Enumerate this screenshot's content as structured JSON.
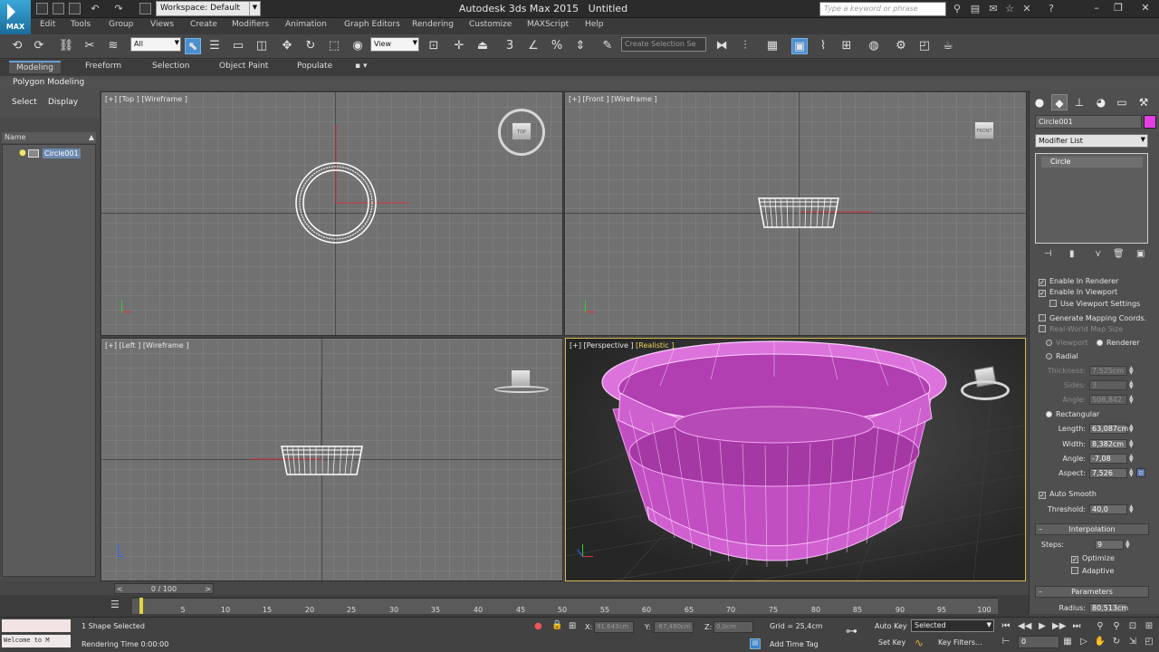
{
  "title_bar": {
    "app_title": "Autodesk 3ds Max  2015",
    "doc_title": "Untitled",
    "workspace": "Workspace: Default",
    "search_placeholder": "Type a keyword or phrase",
    "logo_text": "MAX"
  },
  "menu": [
    "Edit",
    "Tools",
    "Group",
    "Views",
    "Create",
    "Modifiers",
    "Animation",
    "Graph Editors",
    "Rendering",
    "Customize",
    "MAXScript",
    "Help"
  ],
  "toolbar": {
    "selection_filter": "All",
    "reference_coord": "View",
    "named_selection": "Create Selection Se"
  },
  "ribbon": {
    "tabs": [
      "Modeling",
      "Freeform",
      "Selection",
      "Object Paint",
      "Populate"
    ],
    "active": "Modeling",
    "sub_label": "Polygon Modeling"
  },
  "explorer": {
    "tabs": [
      "Select",
      "Display"
    ],
    "column": "Name",
    "object": "Circle001"
  },
  "viewports": {
    "top": "[+] [Top ] [Wireframe ]",
    "front": "[+] [Front ] [Wireframe ]",
    "left": "[+] [Left ] [Wireframe ]",
    "persp_a": "[+] [Perspective ]",
    "persp_b": "[Realistic ]",
    "cube_top": "TOP",
    "cube_front": "FRONT"
  },
  "command_panel": {
    "object_name": "Circle001",
    "object_color": "#e43ee4",
    "modifier_list": "Modifier List",
    "stack_item": "Circle",
    "enable_renderer": "Enable In Renderer",
    "enable_viewport": "Enable In Viewport",
    "use_viewport_settings": "Use Viewport Settings",
    "gen_mapping": "Generate Mapping Coords.",
    "real_world": "Real-World Map Size",
    "viewport_radio": "Viewport",
    "renderer_radio": "Renderer",
    "radial": "Radial",
    "thickness_label": "Thickness:",
    "thickness": "7,525cm",
    "sides_label": "Sides:",
    "sides": "3",
    "angle_label": "Angle:",
    "angle_radial": "508,842",
    "rectangular": "Rectangular",
    "length_label": "Length:",
    "length": "63,087cm",
    "width_label": "Width:",
    "width": "8,382cm",
    "angle_rect": "-7,08",
    "aspect_label": "Aspect:",
    "aspect": "7,526",
    "auto_smooth": "Auto Smooth",
    "threshold_label": "Threshold:",
    "threshold": "40,0",
    "interpolation": "Interpolation",
    "steps_label": "Steps:",
    "steps": "9",
    "optimize": "Optimize",
    "adaptive": "Adaptive",
    "parameters": "Parameters",
    "radius_label": "Radius:",
    "radius": "80,513cm"
  },
  "timeline": {
    "frame_range": "0 / 100",
    "ticks": [
      "5",
      "10",
      "15",
      "20",
      "25",
      "30",
      "35",
      "40",
      "45",
      "50",
      "55",
      "60",
      "65",
      "70",
      "75",
      "80",
      "85",
      "90",
      "95",
      "100"
    ]
  },
  "status": {
    "maxscript": "Welcome to M",
    "selection": "1 Shape Selected",
    "render_time": "Rendering Time  0:00:00",
    "x_label": "X:",
    "x": "91,643cm",
    "y_label": "Y:",
    "y": "-67,480cm",
    "z_label": "Z:",
    "z": "0,0cm",
    "grid": "Grid = 25,4cm",
    "add_time_tag": "Add Time Tag",
    "auto_key": "Auto Key",
    "set_key": "Set Key",
    "key_mode": "Selected",
    "key_filters": "Key Filters...",
    "frame": "0"
  }
}
